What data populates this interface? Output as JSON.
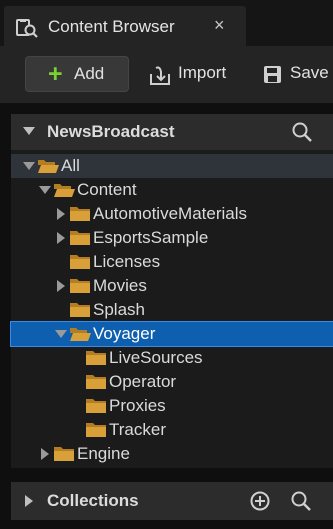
{
  "tab": {
    "title": "Content Browser",
    "close": "×",
    "icon": "content-browser-icon"
  },
  "toolbar": {
    "add_plus": "+",
    "add_label": "Add",
    "import_label": "Import",
    "save_label": "Save"
  },
  "panel": {
    "title": "NewsBroadcast"
  },
  "tree": [
    {
      "label": "All",
      "depth": 0,
      "expanded": true,
      "selected": false,
      "has_children": true
    },
    {
      "label": "Content",
      "depth": 1,
      "expanded": true,
      "selected": false,
      "has_children": true
    },
    {
      "label": "AutomotiveMaterials",
      "depth": 2,
      "expanded": false,
      "selected": false,
      "has_children": true
    },
    {
      "label": "EsportsSample",
      "depth": 2,
      "expanded": false,
      "selected": false,
      "has_children": true
    },
    {
      "label": "Licenses",
      "depth": 2,
      "expanded": false,
      "selected": false,
      "has_children": false
    },
    {
      "label": "Movies",
      "depth": 2,
      "expanded": false,
      "selected": false,
      "has_children": true
    },
    {
      "label": "Splash",
      "depth": 2,
      "expanded": false,
      "selected": false,
      "has_children": false
    },
    {
      "label": "Voyager",
      "depth": 2,
      "expanded": true,
      "selected": true,
      "has_children": true
    },
    {
      "label": "LiveSources",
      "depth": 3,
      "expanded": false,
      "selected": false,
      "has_children": false
    },
    {
      "label": "Operator",
      "depth": 3,
      "expanded": false,
      "selected": false,
      "has_children": false
    },
    {
      "label": "Proxies",
      "depth": 3,
      "expanded": false,
      "selected": false,
      "has_children": false
    },
    {
      "label": "Tracker",
      "depth": 3,
      "expanded": false,
      "selected": false,
      "has_children": false
    },
    {
      "label": "Engine",
      "depth": 1,
      "expanded": false,
      "selected": false,
      "has_children": true
    }
  ],
  "collections": {
    "title": "Collections"
  },
  "colors": {
    "folder": "#d9a03a",
    "folder_dark": "#b37d22",
    "selection": "#0f5fb0",
    "add_green": "#7bd12e"
  }
}
